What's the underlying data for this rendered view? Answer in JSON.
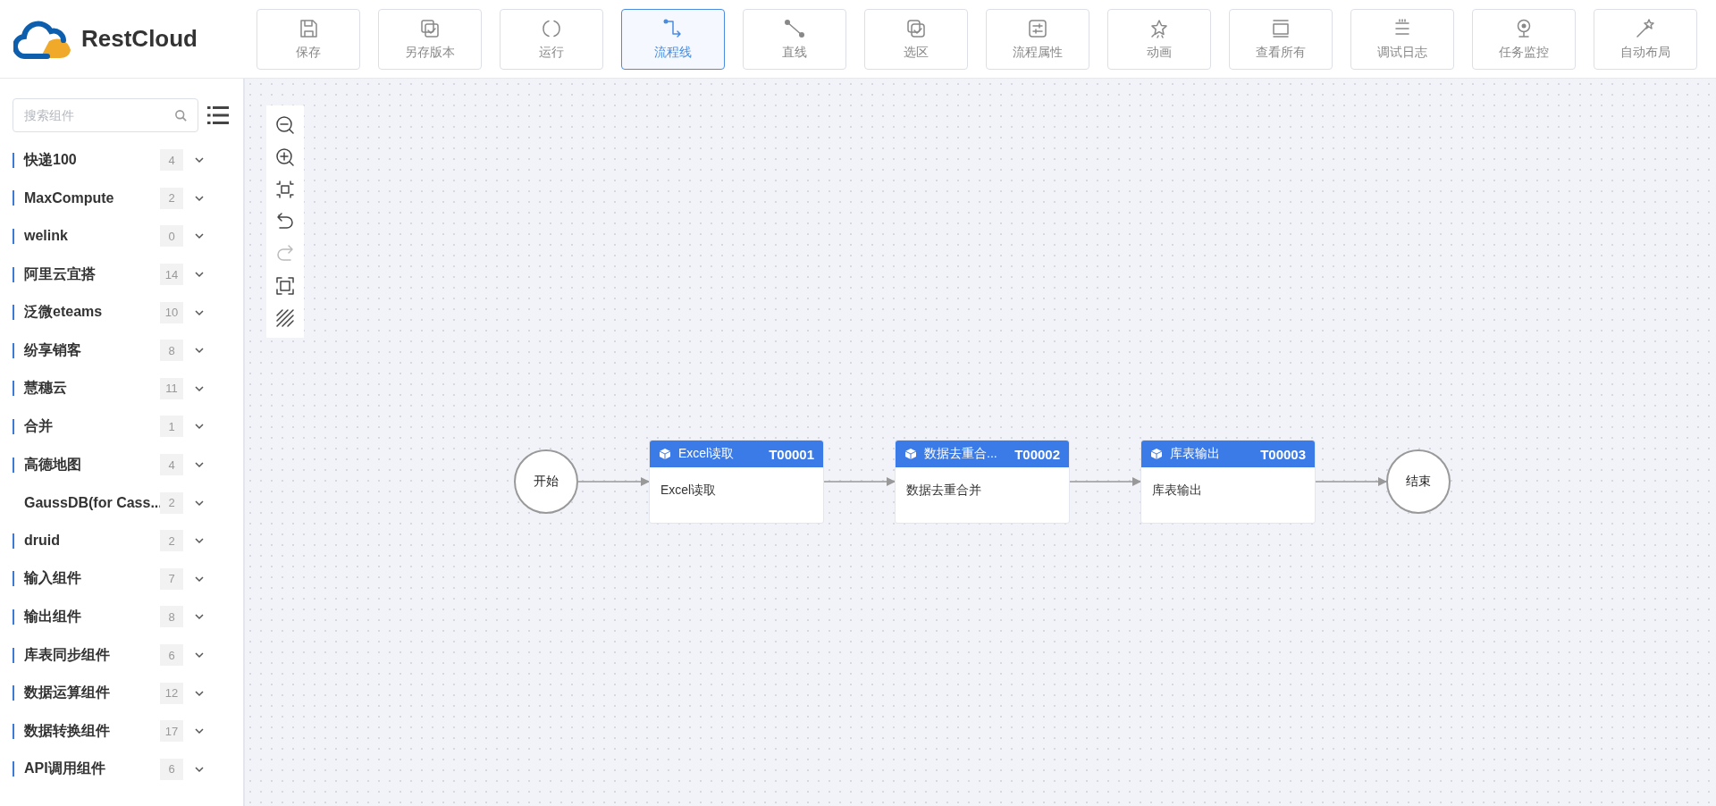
{
  "logo": {
    "text": "RestCloud"
  },
  "toolbar": [
    {
      "label": "保存",
      "kind": "save",
      "selected": false
    },
    {
      "label": "另存版本",
      "kind": "copy",
      "selected": false
    },
    {
      "label": "运行",
      "kind": "run",
      "selected": false
    },
    {
      "label": "流程线",
      "kind": "polyline",
      "selected": true
    },
    {
      "label": "直线",
      "kind": "line",
      "selected": false
    },
    {
      "label": "选区",
      "kind": "select",
      "selected": false
    },
    {
      "label": "流程属性",
      "kind": "props",
      "selected": false
    },
    {
      "label": "动画",
      "kind": "star",
      "selected": false
    },
    {
      "label": "查看所有",
      "kind": "view",
      "selected": false
    },
    {
      "label": "调试日志",
      "kind": "log",
      "selected": false
    },
    {
      "label": "任务监控",
      "kind": "monitor",
      "selected": false
    },
    {
      "label": "自动布局",
      "kind": "wand",
      "selected": false
    }
  ],
  "sidebar": {
    "search": {
      "placeholder": "搜索组件"
    },
    "items": [
      {
        "label": "快递100",
        "count": "4",
        "marked": true
      },
      {
        "label": "MaxCompute",
        "count": "2",
        "marked": true
      },
      {
        "label": "welink",
        "count": "0",
        "marked": true
      },
      {
        "label": "阿里云宜搭",
        "count": "14",
        "marked": true
      },
      {
        "label": "泛微eteams",
        "count": "10",
        "marked": true
      },
      {
        "label": "纷享销客",
        "count": "8",
        "marked": true
      },
      {
        "label": "慧穗云",
        "count": "11",
        "marked": true
      },
      {
        "label": "合并",
        "count": "1",
        "marked": true
      },
      {
        "label": "高德地图",
        "count": "4",
        "marked": true
      },
      {
        "label": "GaussDB(for Cass...",
        "count": "2",
        "marked": false
      },
      {
        "label": "druid",
        "count": "2",
        "marked": true
      },
      {
        "label": "输入组件",
        "count": "7",
        "marked": true
      },
      {
        "label": "输出组件",
        "count": "8",
        "marked": true
      },
      {
        "label": "库表同步组件",
        "count": "6",
        "marked": true
      },
      {
        "label": "数据运算组件",
        "count": "12",
        "marked": true
      },
      {
        "label": "数据转换组件",
        "count": "17",
        "marked": true
      },
      {
        "label": "API调用组件",
        "count": "6",
        "marked": true
      }
    ]
  },
  "canvas": {
    "zoom_tools": [
      {
        "kind": "zoom-out",
        "disabled": false
      },
      {
        "kind": "zoom-in",
        "disabled": false
      },
      {
        "kind": "fit",
        "disabled": false
      },
      {
        "kind": "undo",
        "disabled": false
      },
      {
        "kind": "redo",
        "disabled": true
      },
      {
        "kind": "fullscreen",
        "disabled": false
      },
      {
        "kind": "grid",
        "disabled": false
      }
    ],
    "nodes": [
      {
        "kind": "start",
        "label": "开始"
      },
      {
        "kind": "task",
        "title": "Excel读取",
        "code": "T00001",
        "body": "Excel读取"
      },
      {
        "kind": "task",
        "title": "数据去重合...",
        "code": "T00002",
        "body": "数据去重合并"
      },
      {
        "kind": "task",
        "title": "库表输出",
        "code": "T00003",
        "body": "库表输出"
      },
      {
        "kind": "end",
        "label": "结束"
      }
    ]
  }
}
